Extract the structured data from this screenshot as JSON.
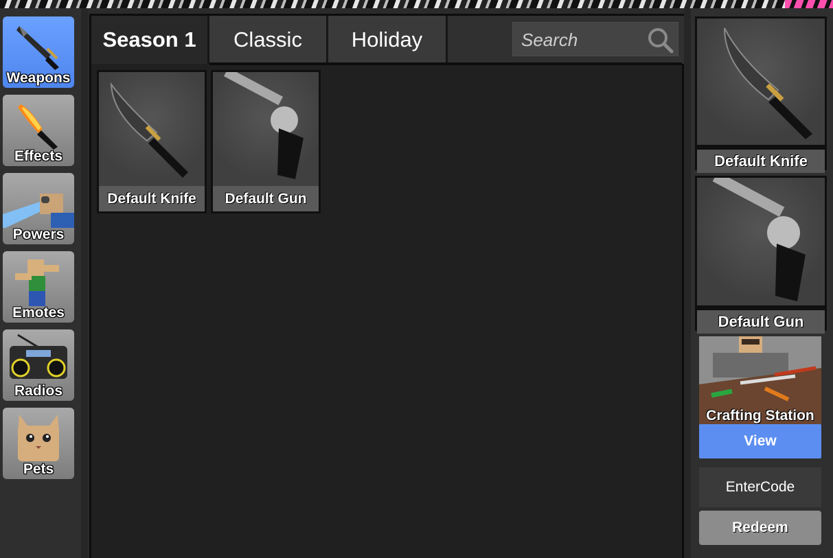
{
  "sidebar": {
    "categories": [
      {
        "label": "Weapons",
        "icon": "knife-icon",
        "active": true
      },
      {
        "label": "Effects",
        "icon": "flaming-knife-icon",
        "active": false
      },
      {
        "label": "Powers",
        "icon": "power-ray-icon",
        "active": false
      },
      {
        "label": "Emotes",
        "icon": "dancing-figure-icon",
        "active": false
      },
      {
        "label": "Radios",
        "icon": "boombox-icon",
        "active": false
      },
      {
        "label": "Pets",
        "icon": "cat-pet-icon",
        "active": false
      }
    ]
  },
  "tabs": [
    {
      "label": "Season 1",
      "active": true
    },
    {
      "label": "Classic",
      "active": false
    },
    {
      "label": "Holiday",
      "active": false
    }
  ],
  "search": {
    "placeholder": "Search",
    "icon": "magnifier-icon"
  },
  "inventory": {
    "items": [
      {
        "name": "Default Knife",
        "icon": "default-knife-icon"
      },
      {
        "name": "Default Gun",
        "icon": "default-revolver-icon"
      }
    ]
  },
  "equipped": {
    "knife": {
      "name": "Default Knife"
    },
    "gun": {
      "name": "Default Gun"
    }
  },
  "crafting": {
    "label": "Crafting Station",
    "view_label": "View"
  },
  "code": {
    "placeholder": "EnterCode",
    "redeem_label": "Redeem"
  },
  "colors": {
    "accent": "#5b8ef0",
    "panel": "#202020",
    "sidebar": "#2f2f2f"
  }
}
